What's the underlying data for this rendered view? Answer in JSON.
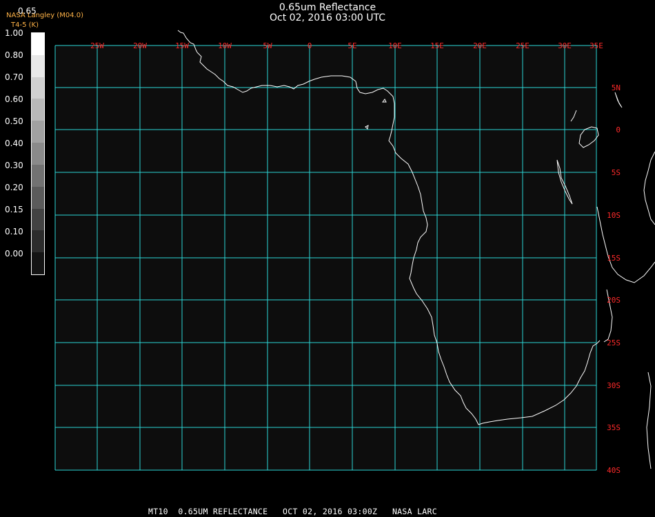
{
  "header": {
    "title": "0.65um Reflectance",
    "datetime": "Oct 02, 2016 03:00 UTC"
  },
  "colorbar": {
    "band_label": "0.65",
    "source": "NASA Langley (M04.0)",
    "unit_label": "T4-5 (K)",
    "ticks": [
      "1.00",
      "0.80",
      "0.70",
      "0.60",
      "0.50",
      "0.40",
      "0.30",
      "0.20",
      "0.15",
      "0.10",
      "0.00"
    ]
  },
  "grid": {
    "lon_labels": [
      "25W",
      "20W",
      "15W",
      "10W",
      "5W",
      "0",
      "5E",
      "10E",
      "15E",
      "20E",
      "25E",
      "30E",
      "35E"
    ],
    "lat_labels": [
      "5N",
      "0",
      "5S",
      "10S",
      "15S",
      "20S",
      "25S",
      "30S",
      "35S",
      "40S"
    ]
  },
  "footer": {
    "text": "MT10  0.65UM REFLECTANCE   OCT 02, 2016 03:00Z   NASA LARC"
  },
  "colors": {
    "grid": "#2bd6d6",
    "labels": "#ff2a2a",
    "coast": "#ffffff",
    "background": "#000000",
    "map_fill": "#0d0d0d"
  }
}
